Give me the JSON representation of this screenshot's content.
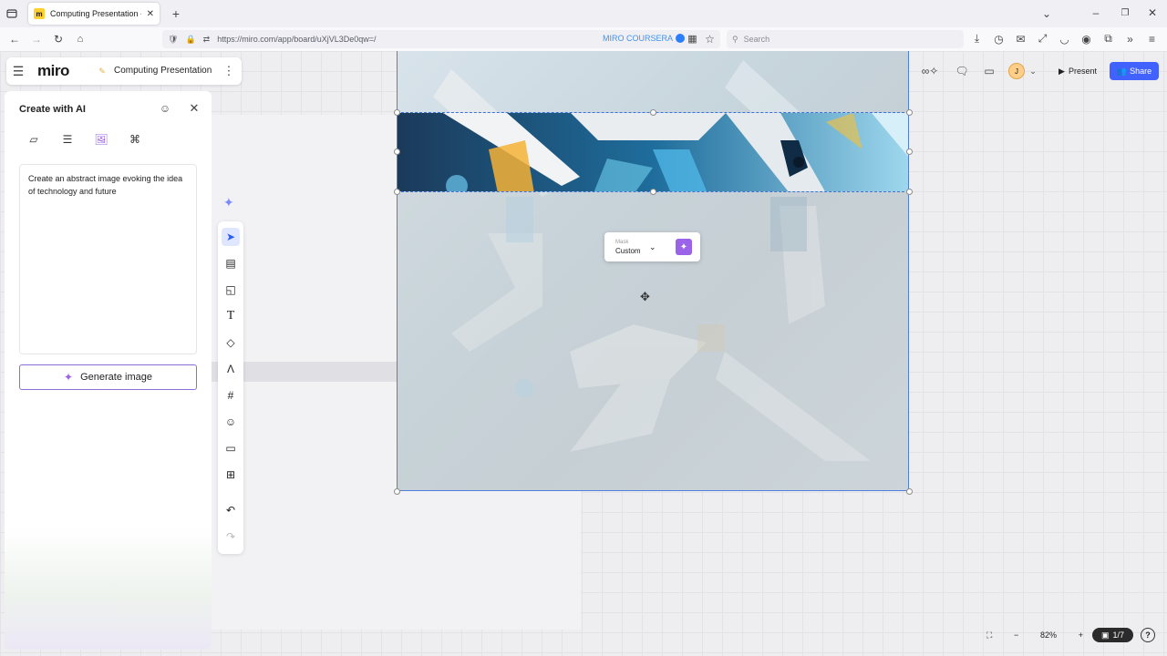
{
  "browser": {
    "tab_title": "Computing Presentation - Miro",
    "url": "https://miro.com/app/board/uXjVL3De0qw=/",
    "extension_label": "MIRO COURSERA",
    "search_placeholder": "Search"
  },
  "miro": {
    "logo": "miro",
    "board_name": "Computing Presentation",
    "avatar_initial": "J",
    "present_label": "Present",
    "share_label": "Share"
  },
  "ai_panel": {
    "title": "Create with AI",
    "prompt_text": "Create an abstract image evoking the idea of technology and future",
    "generate_label": "Generate image"
  },
  "mask_popover": {
    "label": "Mask",
    "value": "Custom"
  },
  "zoom": {
    "level": "82%",
    "pages": "1/7"
  },
  "colors": {
    "share_blue": "#4262ff",
    "ai_purple": "#9a63e8",
    "selection_blue": "#3b73d9"
  }
}
